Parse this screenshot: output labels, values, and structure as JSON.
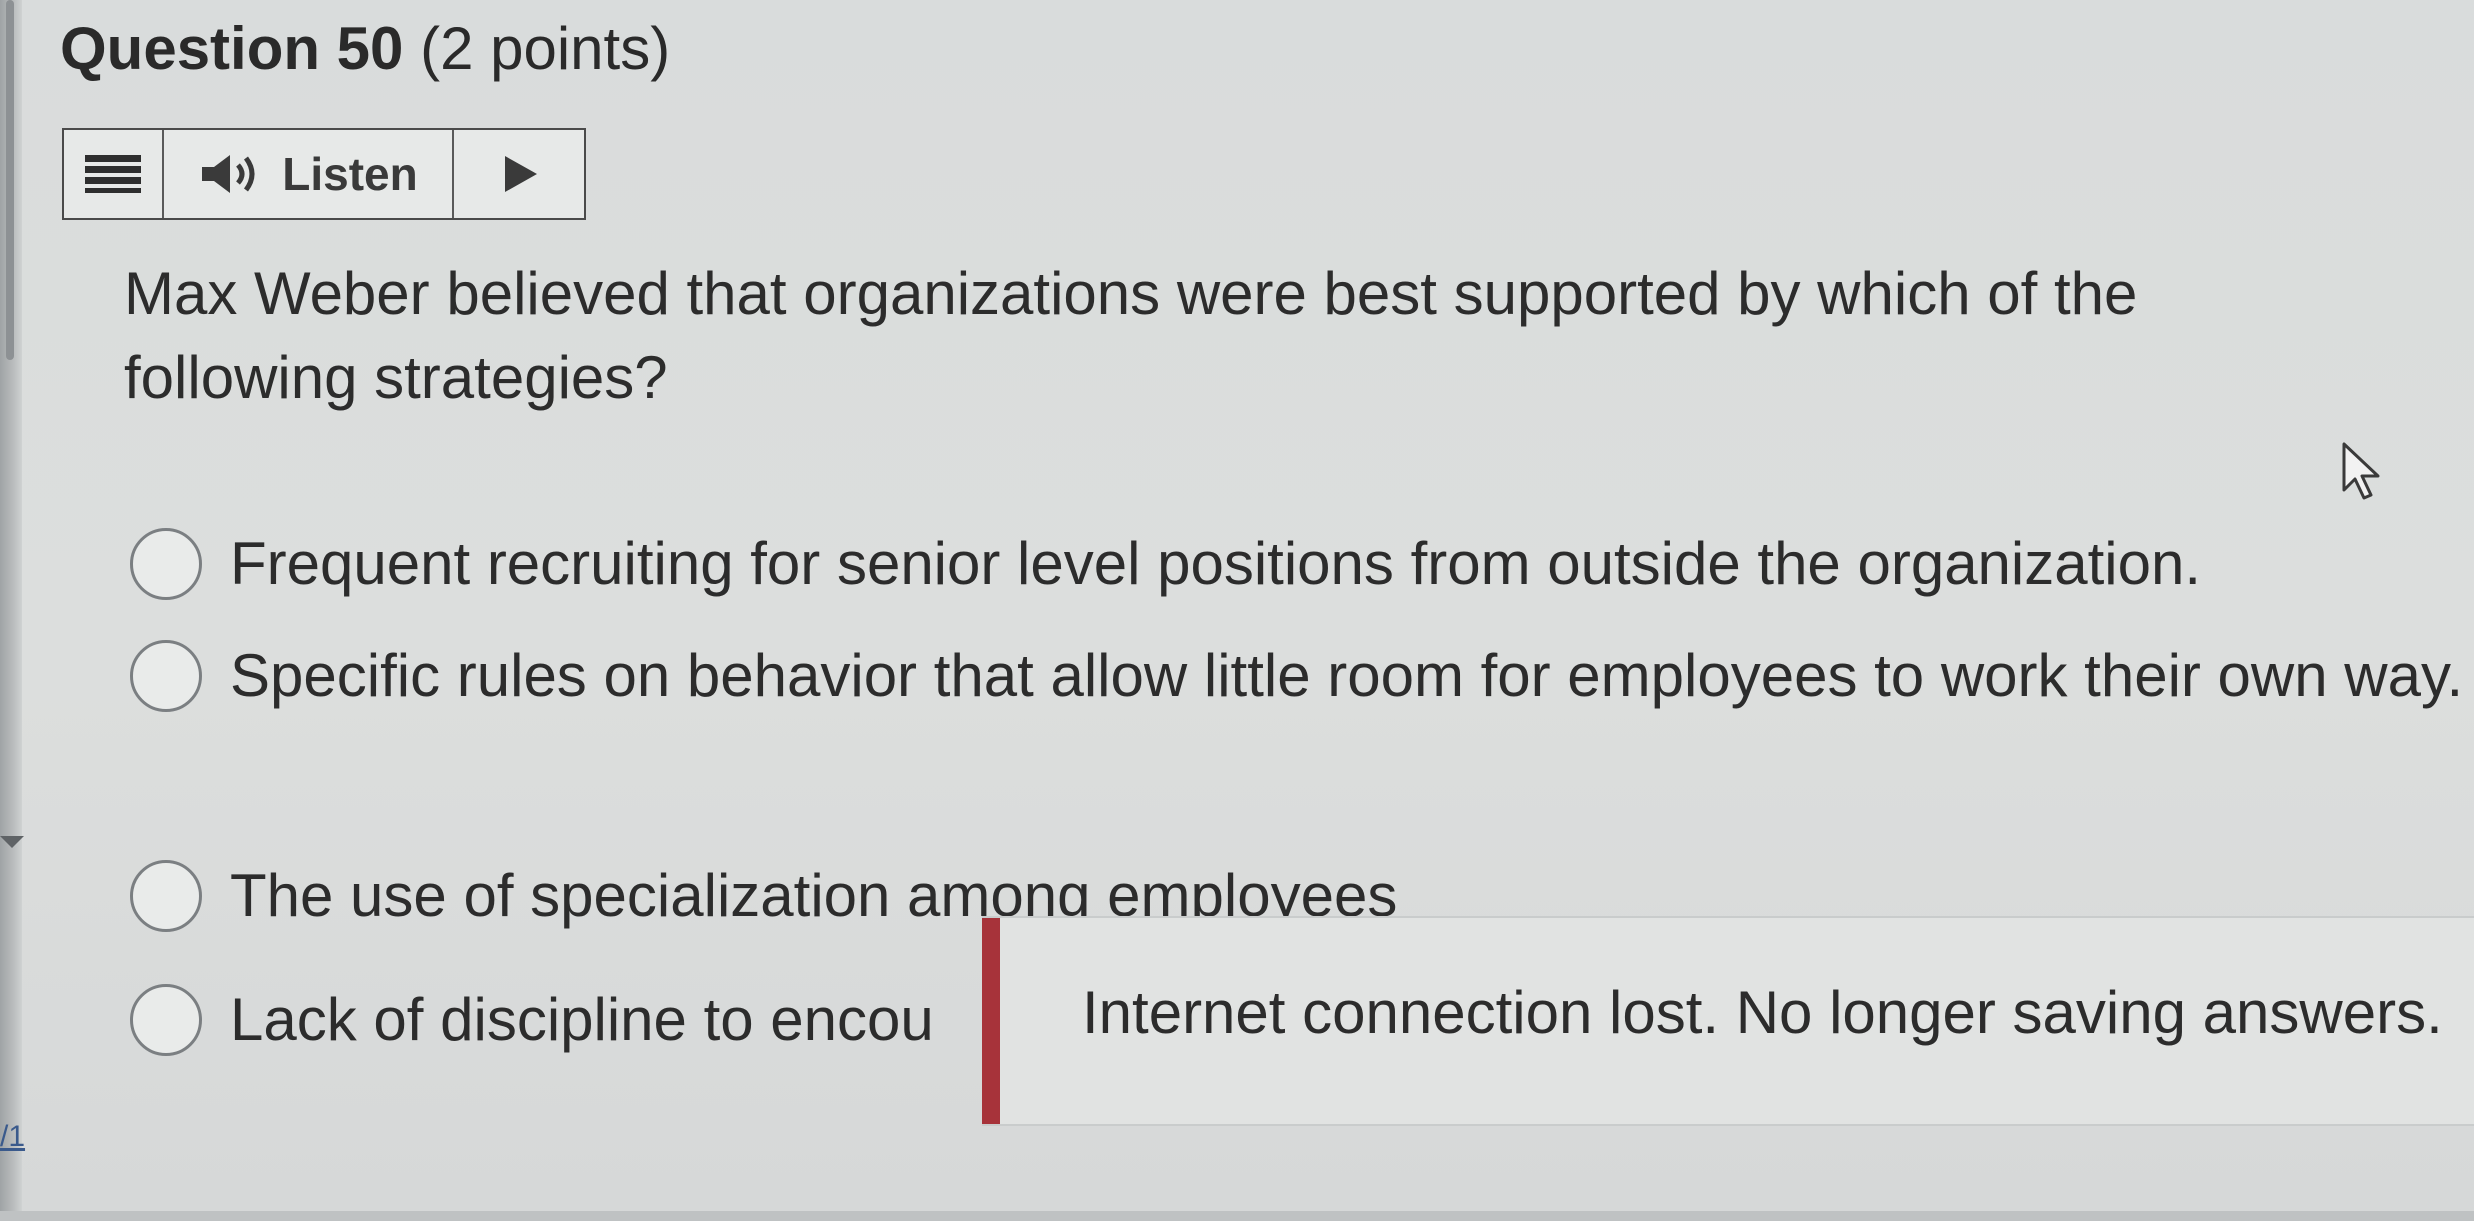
{
  "question": {
    "title_number": "Question 50",
    "title_points": "(2 points)",
    "text": "Max Weber believed that organizations were best supported by which of the following strategies?"
  },
  "toolbar": {
    "menu_icon": "menu-icon",
    "speaker_icon": "speaker-icon",
    "listen_label": "Listen",
    "play_icon": "play-icon"
  },
  "options": [
    {
      "label": "Frequent recruiting for senior level positions from outside the organization.",
      "selected": false
    },
    {
      "label": "Specific rules on behavior that allow little room for employees to work their own way.",
      "selected": false
    },
    {
      "label": "The use of specialization among employees",
      "selected": false
    },
    {
      "label": "Lack of discipline to encou",
      "selected": false
    }
  ],
  "notification": {
    "message": "Internet connection lost. No longer saving answers.",
    "accent_color": "#a7333a"
  },
  "page_counter": "/1",
  "colors": {
    "background": "#dcdedd",
    "text": "#2c2c2c",
    "link": "#3a5a8c"
  }
}
